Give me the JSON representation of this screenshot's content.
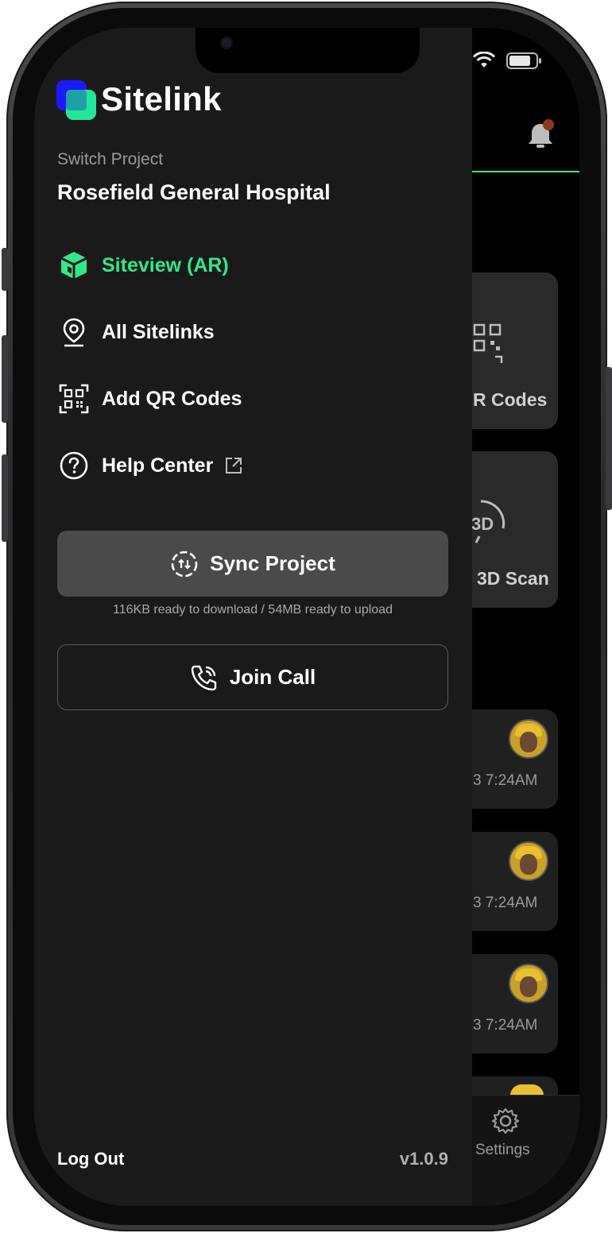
{
  "drawer": {
    "app_name": "Sitelink",
    "switch_project_label": "Switch Project",
    "project_name": "Rosefield General Hospital",
    "menu": [
      {
        "label": "Siteview (AR)",
        "icon": "cube-icon",
        "active": true
      },
      {
        "label": "All Sitelinks",
        "icon": "map-pin-icon",
        "active": false
      },
      {
        "label": "Add QR Codes",
        "icon": "qr-code-icon",
        "active": false
      },
      {
        "label": "Help Center",
        "icon": "help-circle-icon",
        "active": false
      }
    ],
    "sync_button": "Sync Project",
    "sync_info": "116KB ready to download / 54MB ready to upload",
    "join_call_button": "Join Call",
    "logout": "Log Out",
    "version": "v1.0.9"
  },
  "background": {
    "tiles": [
      {
        "label": "R Codes"
      },
      {
        "label": "3D Scan"
      }
    ],
    "list_times": [
      "3 7:24AM",
      "3 7:24AM",
      "3 7:24AM"
    ],
    "tabbar_settings": "Settings"
  },
  "colors": {
    "accent": "#2ee88a",
    "drawer_bg": "#1a1a1a",
    "notification_dot": "#8b3a1e"
  }
}
